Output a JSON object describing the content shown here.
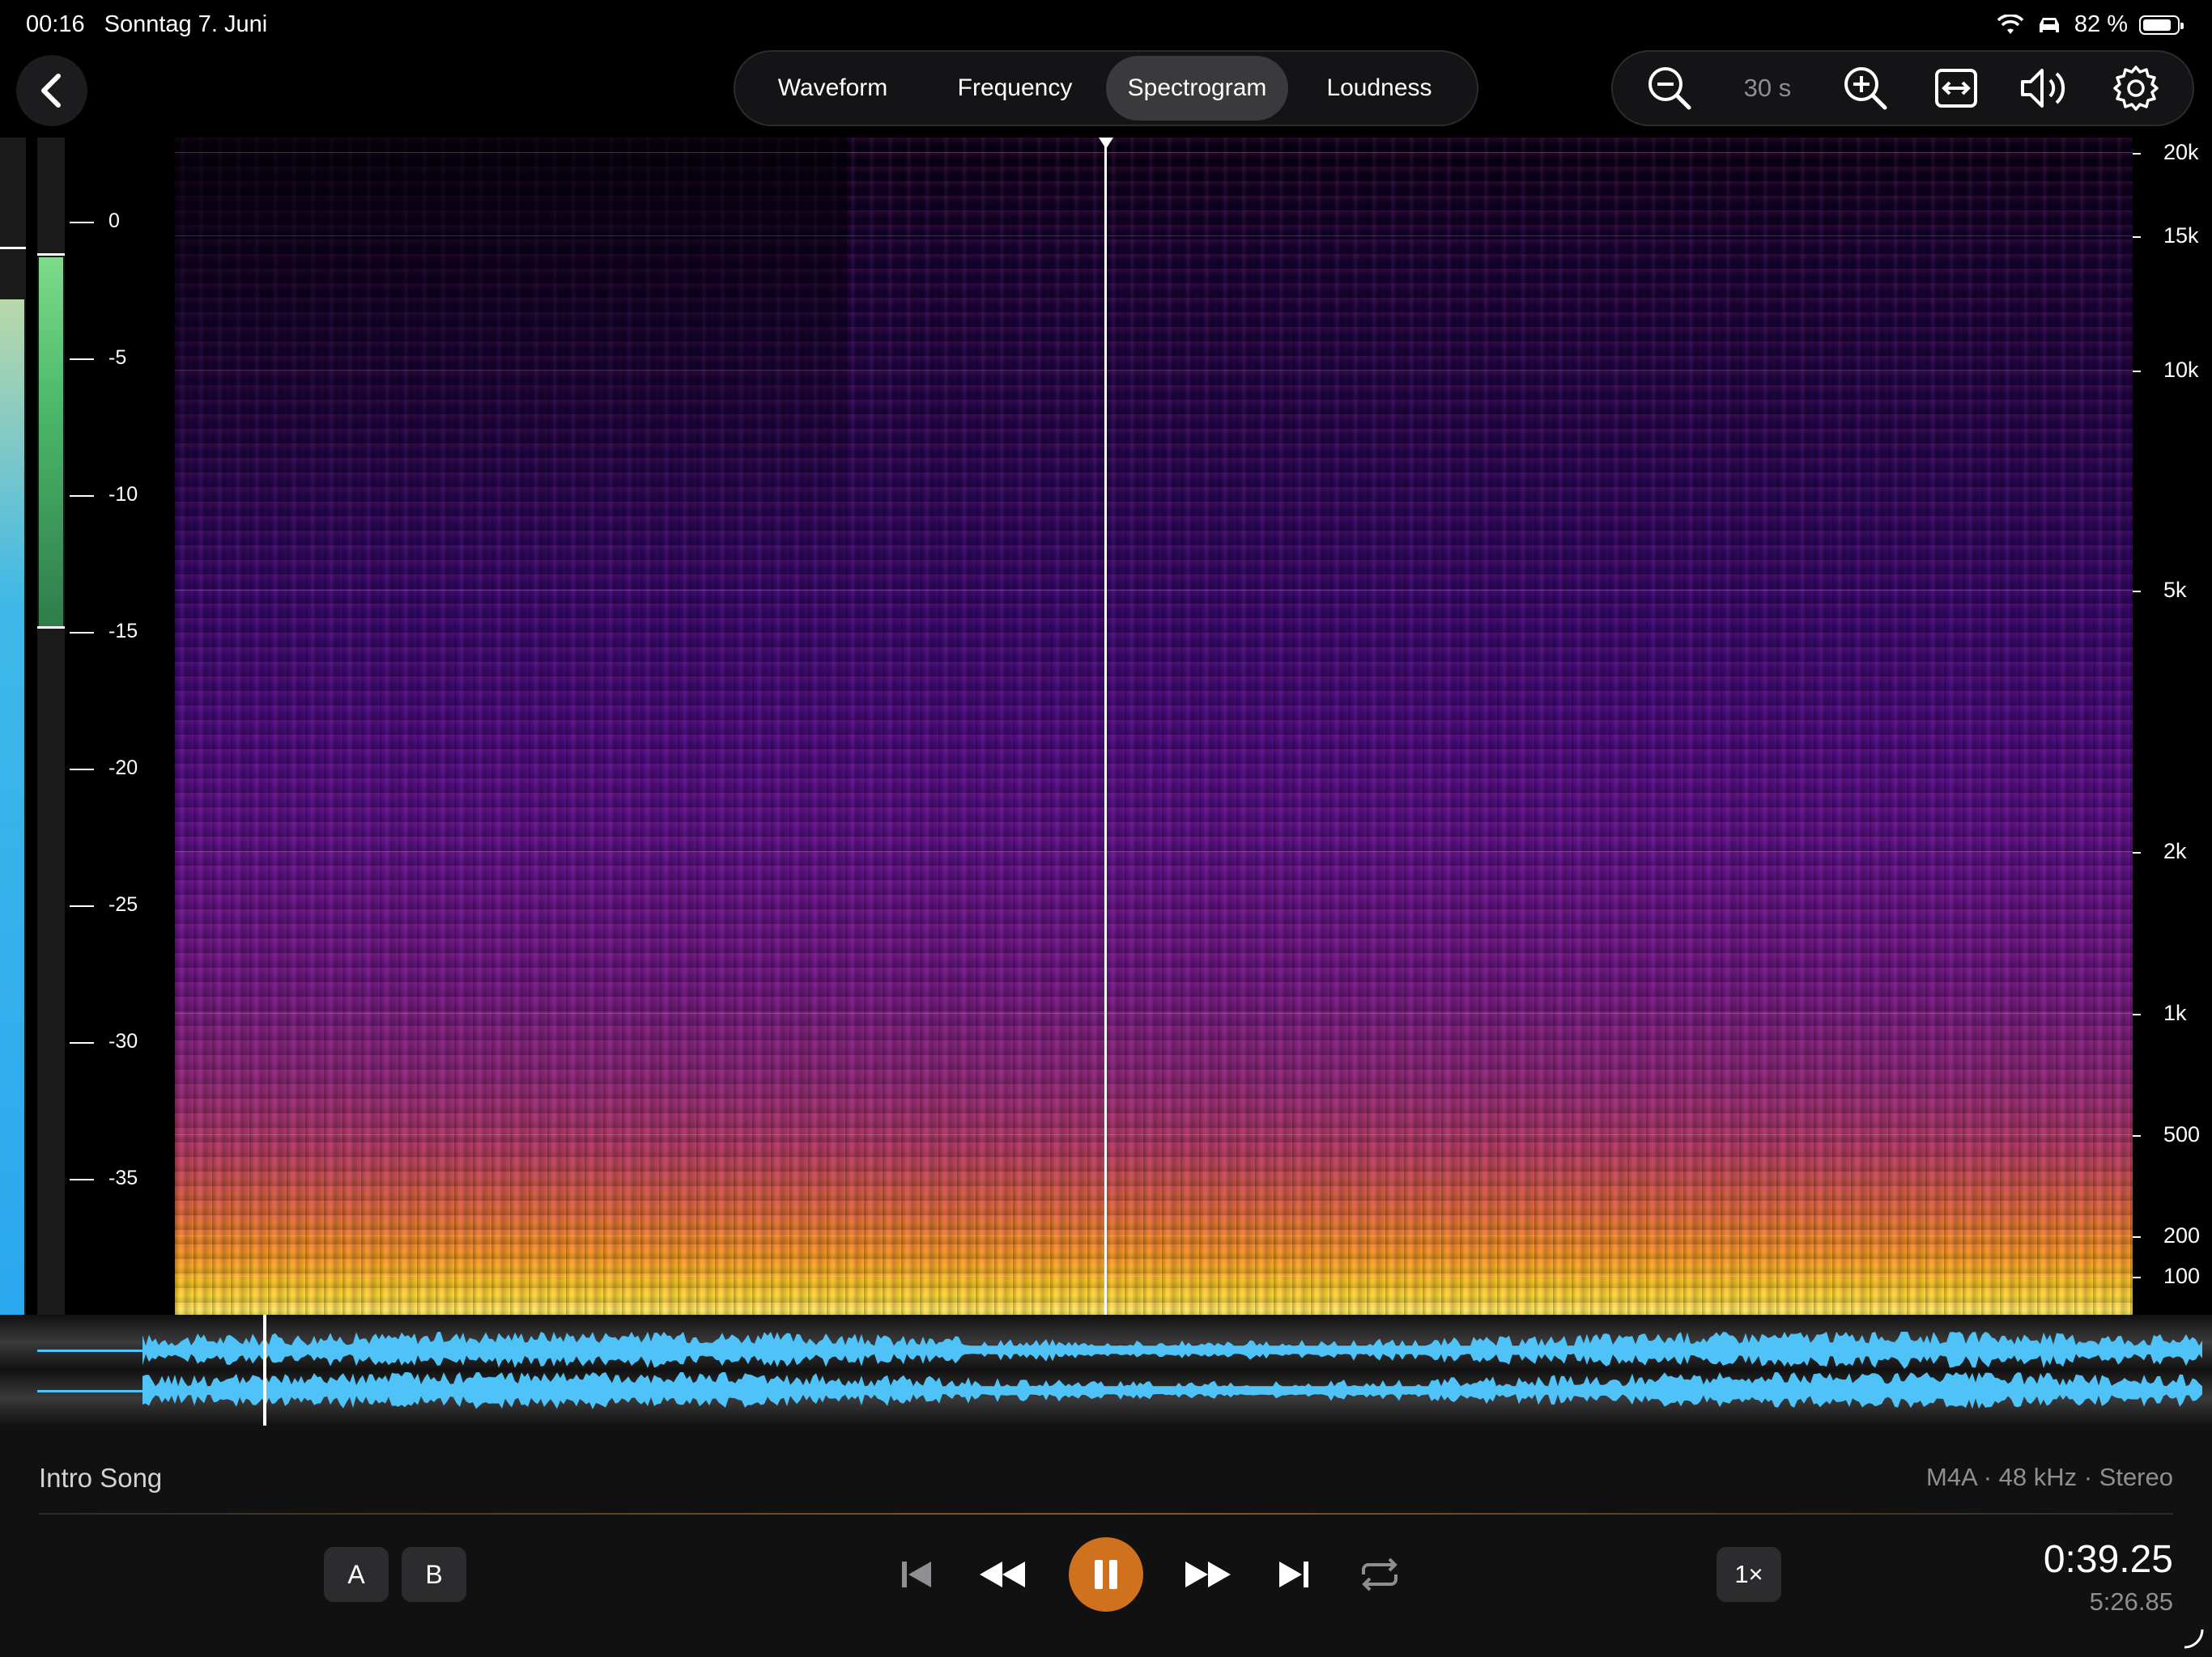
{
  "status_bar": {
    "time": "00:16",
    "date": "Sonntag 7. Juni",
    "battery": "82 %"
  },
  "tabs": [
    {
      "label": "Waveform",
      "active": false
    },
    {
      "label": "Frequency",
      "active": false
    },
    {
      "label": "Spectrogram",
      "active": true
    },
    {
      "label": "Loudness",
      "active": false
    }
  ],
  "toolbar": {
    "zoom_window": "30 s",
    "icons": [
      "zoom-out-icon",
      "zoom-in-icon",
      "fit-width-icon",
      "volume-icon",
      "gear-icon"
    ]
  },
  "meter": {
    "db_scale": [
      "0",
      "-5",
      "-10",
      "-15",
      "-20",
      "-25",
      "-30",
      "-35"
    ],
    "level_fraction": 0.8,
    "loudness_fraction": 0.7
  },
  "spectrogram": {
    "freq_scale": [
      "20k",
      "15k",
      "10k",
      "5k",
      "2k",
      "1k",
      "500",
      "200",
      "100"
    ],
    "playhead_fraction": 0.179
  },
  "track": {
    "title": "Intro Song",
    "format": "M4A · 48 kHz · Stereo"
  },
  "transport": {
    "a_label": "A",
    "b_label": "B",
    "speed": "1×",
    "current_time": "0:39.25",
    "duration": "5:26.85"
  },
  "colors": {
    "accent": "#d0711e",
    "waveform": "#4fc3f7",
    "meter_green": "#4cd964"
  }
}
